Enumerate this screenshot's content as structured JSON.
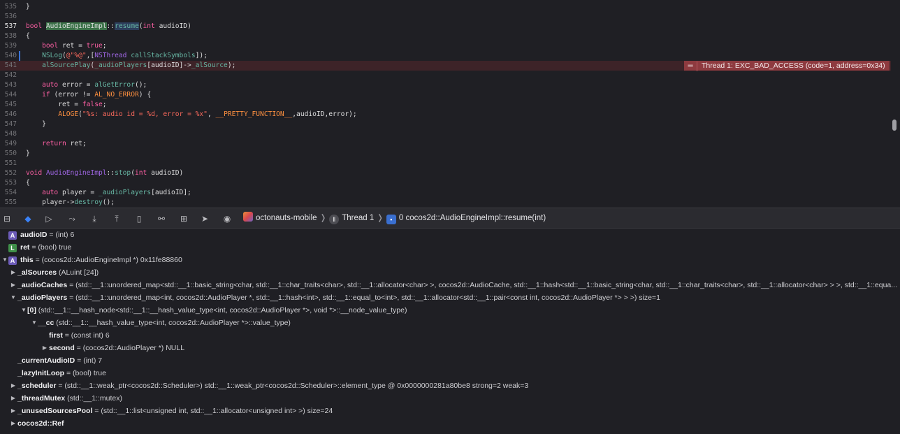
{
  "editor": {
    "lines": [
      {
        "num": "535",
        "tokens": [
          {
            "t": "}",
            "c": ""
          }
        ]
      },
      {
        "num": "536",
        "tokens": []
      },
      {
        "num": "537",
        "current": true,
        "tokens": [
          {
            "t": "bool",
            "c": "kw"
          },
          {
            "t": " ",
            "c": ""
          },
          {
            "t": "AudioEngineImpl",
            "c": "cls hl"
          },
          {
            "t": "::",
            "c": ""
          },
          {
            "t": "resume",
            "c": "fn hl2"
          },
          {
            "t": "(",
            "c": ""
          },
          {
            "t": "int",
            "c": "kw"
          },
          {
            "t": " audioID)",
            "c": ""
          }
        ]
      },
      {
        "num": "538",
        "tokens": [
          {
            "t": "{",
            "c": ""
          }
        ]
      },
      {
        "num": "539",
        "tokens": [
          {
            "t": "    ",
            "c": ""
          },
          {
            "t": "bool",
            "c": "kw"
          },
          {
            "t": " ret = ",
            "c": ""
          },
          {
            "t": "true",
            "c": "kw"
          },
          {
            "t": ";",
            "c": ""
          }
        ]
      },
      {
        "num": "540",
        "modified": true,
        "tokens": [
          {
            "t": "    ",
            "c": ""
          },
          {
            "t": "NSLog",
            "c": "fn"
          },
          {
            "t": "(",
            "c": ""
          },
          {
            "t": "@\"%@\"",
            "c": "str"
          },
          {
            "t": ",[",
            "c": ""
          },
          {
            "t": "NSThread",
            "c": "cls"
          },
          {
            "t": " ",
            "c": ""
          },
          {
            "t": "callStackSymbols",
            "c": "fn"
          },
          {
            "t": "]);",
            "c": ""
          }
        ]
      },
      {
        "num": "541",
        "error": true,
        "tokens": [
          {
            "t": "    ",
            "c": ""
          },
          {
            "t": "alSourcePlay",
            "c": "fn"
          },
          {
            "t": "(",
            "c": ""
          },
          {
            "t": "_audioPlayers",
            "c": "fn"
          },
          {
            "t": "[audioID]->",
            "c": ""
          },
          {
            "t": "_alSource",
            "c": "fn"
          },
          {
            "t": ");",
            "c": ""
          }
        ]
      },
      {
        "num": "542",
        "tokens": []
      },
      {
        "num": "543",
        "tokens": [
          {
            "t": "    ",
            "c": ""
          },
          {
            "t": "auto",
            "c": "kw"
          },
          {
            "t": " error = ",
            "c": ""
          },
          {
            "t": "alGetError",
            "c": "fn"
          },
          {
            "t": "();",
            "c": ""
          }
        ]
      },
      {
        "num": "544",
        "tokens": [
          {
            "t": "    ",
            "c": ""
          },
          {
            "t": "if",
            "c": "kw"
          },
          {
            "t": " (error != ",
            "c": ""
          },
          {
            "t": "AL_NO_ERROR",
            "c": "mac"
          },
          {
            "t": ") {",
            "c": ""
          }
        ]
      },
      {
        "num": "545",
        "tokens": [
          {
            "t": "        ret = ",
            "c": ""
          },
          {
            "t": "false",
            "c": "kw"
          },
          {
            "t": ";",
            "c": ""
          }
        ]
      },
      {
        "num": "546",
        "tokens": [
          {
            "t": "        ",
            "c": ""
          },
          {
            "t": "ALOGE",
            "c": "mac"
          },
          {
            "t": "(",
            "c": ""
          },
          {
            "t": "\"%s: audio id = %d, error = %x\"",
            "c": "str"
          },
          {
            "t": ", ",
            "c": ""
          },
          {
            "t": "__PRETTY_FUNCTION__",
            "c": "mac"
          },
          {
            "t": ",audioID,error);",
            "c": ""
          }
        ]
      },
      {
        "num": "547",
        "tokens": [
          {
            "t": "    }",
            "c": ""
          }
        ]
      },
      {
        "num": "548",
        "tokens": []
      },
      {
        "num": "549",
        "tokens": [
          {
            "t": "    ",
            "c": ""
          },
          {
            "t": "return",
            "c": "kw"
          },
          {
            "t": " ret;",
            "c": ""
          }
        ]
      },
      {
        "num": "550",
        "tokens": [
          {
            "t": "}",
            "c": ""
          }
        ]
      },
      {
        "num": "551",
        "tokens": []
      },
      {
        "num": "552",
        "tokens": [
          {
            "t": "void",
            "c": "kw"
          },
          {
            "t": " ",
            "c": ""
          },
          {
            "t": "AudioEngineImpl",
            "c": "cls"
          },
          {
            "t": "::",
            "c": ""
          },
          {
            "t": "stop",
            "c": "fn"
          },
          {
            "t": "(",
            "c": ""
          },
          {
            "t": "int",
            "c": "kw"
          },
          {
            "t": " audioID)",
            "c": ""
          }
        ]
      },
      {
        "num": "553",
        "tokens": [
          {
            "t": "{",
            "c": ""
          }
        ]
      },
      {
        "num": "554",
        "tokens": [
          {
            "t": "    ",
            "c": ""
          },
          {
            "t": "auto",
            "c": "kw"
          },
          {
            "t": " player = ",
            "c": ""
          },
          {
            "t": "_audioPlayers",
            "c": "fn"
          },
          {
            "t": "[audioID];",
            "c": ""
          }
        ]
      },
      {
        "num": "555",
        "tokens": [
          {
            "t": "    player->",
            "c": ""
          },
          {
            "t": "destroy",
            "c": "fn"
          },
          {
            "t": "();",
            "c": ""
          }
        ]
      }
    ],
    "error_message": "Thread 1: EXC_BAD_ACCESS (code=1, address=0x34)"
  },
  "toolbar": {
    "buttons": [
      {
        "name": "hide-debug-area-button",
        "glyph": "⊟"
      },
      {
        "name": "breakpoints-toggle-button",
        "glyph": "◆",
        "active": true
      },
      {
        "name": "continue-button",
        "glyph": "▷"
      },
      {
        "name": "step-over-button",
        "glyph": "⤳"
      },
      {
        "name": "step-into-button",
        "glyph": "⤓"
      },
      {
        "name": "step-out-button",
        "glyph": "⤒"
      },
      {
        "name": "debug-view-hierarchy-button",
        "glyph": "▯"
      },
      {
        "name": "memory-graph-button",
        "glyph": "⚯"
      },
      {
        "name": "environment-overrides-button",
        "glyph": "⊞"
      },
      {
        "name": "simulate-location-button",
        "glyph": "➤"
      },
      {
        "name": "capture-gpu-button",
        "glyph": "◉"
      }
    ],
    "breadcrumbs": {
      "app": "octonauts-mobile",
      "thread": "Thread 1",
      "frame": "0 cocos2d::AudioEngineImpl::resume(int)"
    }
  },
  "variables": [
    {
      "indent": 0,
      "triangle": "",
      "badge": "A",
      "name": "audioID",
      "detail": " = (int) 6"
    },
    {
      "indent": 0,
      "triangle": "",
      "badge": "L",
      "name": "ret",
      "detail": " = (bool) true"
    },
    {
      "indent": 0,
      "triangle": "open",
      "badge": "A",
      "name": "this",
      "detail": " = (cocos2d::AudioEngineImpl *) 0x11fe88860"
    },
    {
      "indent": 1,
      "triangle": "closed",
      "badge": "",
      "name": "_alSources",
      "detail": " (ALuint [24])"
    },
    {
      "indent": 1,
      "triangle": "closed",
      "badge": "",
      "name": "_audioCaches",
      "detail": " = (std::__1::unordered_map<std::__1::basic_string<char, std::__1::char_traits<char>, std::__1::allocator<char> >, cocos2d::AudioCache, std::__1::hash<std::__1::basic_string<char, std::__1::char_traits<char>, std::__1::allocator<char> > >, std::__1::equa..."
    },
    {
      "indent": 1,
      "triangle": "open",
      "badge": "",
      "name": "_audioPlayers",
      "detail": " = (std::__1::unordered_map<int, cocos2d::AudioPlayer *, std::__1::hash<int>, std::__1::equal_to<int>, std::__1::allocator<std::__1::pair<const int, cocos2d::AudioPlayer *> > >) size=1"
    },
    {
      "indent": 2,
      "triangle": "open",
      "badge": "",
      "name": "[0]",
      "detail": " (std::__1::__hash_node<std::__1::__hash_value_type<int, cocos2d::AudioPlayer *>, void *>::__node_value_type)"
    },
    {
      "indent": 3,
      "triangle": "open",
      "badge": "",
      "name": "__cc",
      "detail": " (std::__1::__hash_value_type<int, cocos2d::AudioPlayer *>::value_type)"
    },
    {
      "indent": 4,
      "triangle": "",
      "badge": "",
      "name": "first",
      "detail": " = (const int) 6"
    },
    {
      "indent": 4,
      "triangle": "closed",
      "badge": "",
      "name": "second",
      "detail": " = (cocos2d::AudioPlayer *) NULL"
    },
    {
      "indent": 1,
      "triangle": "",
      "badge": "",
      "name": "_currentAudioID",
      "detail": " = (int) 7"
    },
    {
      "indent": 1,
      "triangle": "",
      "badge": "",
      "name": "_lazyInitLoop",
      "detail": " = (bool) true"
    },
    {
      "indent": 1,
      "triangle": "closed",
      "badge": "",
      "name": "_scheduler",
      "detail": " = (std::__1::weak_ptr<cocos2d::Scheduler>) std::__1::weak_ptr<cocos2d::Scheduler>::element_type @ 0x0000000281a80be8 strong=2 weak=3"
    },
    {
      "indent": 1,
      "triangle": "closed",
      "badge": "",
      "name": "_threadMutex",
      "detail": " (std::__1::mutex)"
    },
    {
      "indent": 1,
      "triangle": "closed",
      "badge": "",
      "name": "_unusedSourcesPool",
      "detail": " = (std::__1::list<unsigned int, std::__1::allocator<unsigned int> >) size=24"
    },
    {
      "indent": 1,
      "triangle": "closed",
      "badge": "",
      "name": "cocos2d::Ref",
      "detail": ""
    }
  ]
}
